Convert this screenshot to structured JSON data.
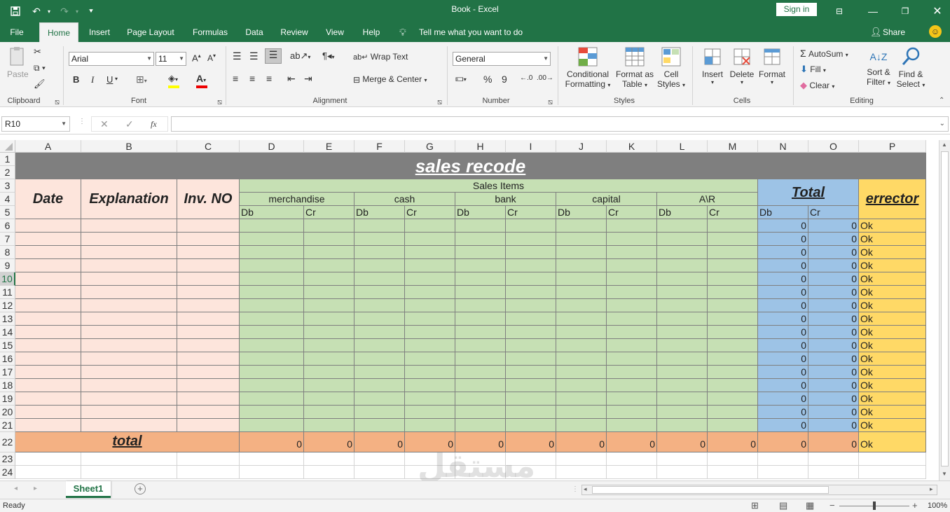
{
  "titlebar": {
    "title": "Book  -  Excel",
    "signin": "Sign in"
  },
  "tabs": [
    "File",
    "Home",
    "Insert",
    "Page Layout",
    "Formulas",
    "Data",
    "Review",
    "View",
    "Help"
  ],
  "tellme": "Tell me what you want to do",
  "share": "Share",
  "ribbon": {
    "clipboard": {
      "label": "Clipboard",
      "paste": "Paste"
    },
    "font": {
      "label": "Font",
      "name": "Arial",
      "size": "11",
      "bold": "B",
      "italic": "I",
      "underline": "U"
    },
    "alignment": {
      "label": "Alignment",
      "wrap": "Wrap Text",
      "merge": "Merge & Center"
    },
    "number": {
      "label": "Number",
      "format": "General",
      "percent": "%",
      "comma": "9"
    },
    "styles": {
      "label": "Styles",
      "cond1": "Conditional",
      "cond2": "Formatting",
      "fmt1": "Format as",
      "fmt2": "Table",
      "cell1": "Cell",
      "cell2": "Styles"
    },
    "cells": {
      "label": "Cells",
      "insert": "Insert",
      "delete": "Delete",
      "format": "Format"
    },
    "editing": {
      "label": "Editing",
      "autosum": "AutoSum",
      "fill": "Fill",
      "clear": "Clear",
      "sort1": "Sort &",
      "sort2": "Filter",
      "find1": "Find &",
      "find2": "Select"
    }
  },
  "formula": {
    "namebox": "R10",
    "fx": "fx",
    "value": ""
  },
  "columns": [
    "A",
    "B",
    "C",
    "D",
    "E",
    "F",
    "G",
    "H",
    "I",
    "J",
    "K",
    "L",
    "M",
    "N",
    "O",
    "P"
  ],
  "rows": [
    "1",
    "2",
    "3",
    "4",
    "5",
    "6",
    "7",
    "8",
    "9",
    "10",
    "11",
    "12",
    "13",
    "14",
    "15",
    "16",
    "17",
    "18",
    "19",
    "20",
    "21",
    "22",
    "23",
    "24"
  ],
  "sheet": {
    "title": "sales recode",
    "sales_items": "Sales Items",
    "date": "Date",
    "explanation": "Explanation",
    "invno": "Inv. NO",
    "total": "Total",
    "errector": "errector",
    "groups": [
      "merchandise",
      "cash",
      "bank",
      "capital",
      "A\\R"
    ],
    "db": "Db",
    "cr": "Cr",
    "row_total_values": [
      "0",
      "0"
    ],
    "ok": "Ok",
    "total_label": "total",
    "total_row": [
      "0",
      "0",
      "0",
      "0",
      "0",
      "0",
      "0",
      "0",
      "0",
      "0",
      "0",
      "0"
    ],
    "total_row_ok": "Ok"
  },
  "sheettab": "Sheet1",
  "status": {
    "ready": "Ready",
    "zoom": "100%"
  },
  "colors": {
    "accent": "#217346",
    "pink": "#fde5dc",
    "green": "#c6e0b4",
    "blue": "#9dc3e6",
    "yellow": "#ffd966",
    "orange": "#f4b183",
    "title_bg": "#7f7f7f"
  }
}
